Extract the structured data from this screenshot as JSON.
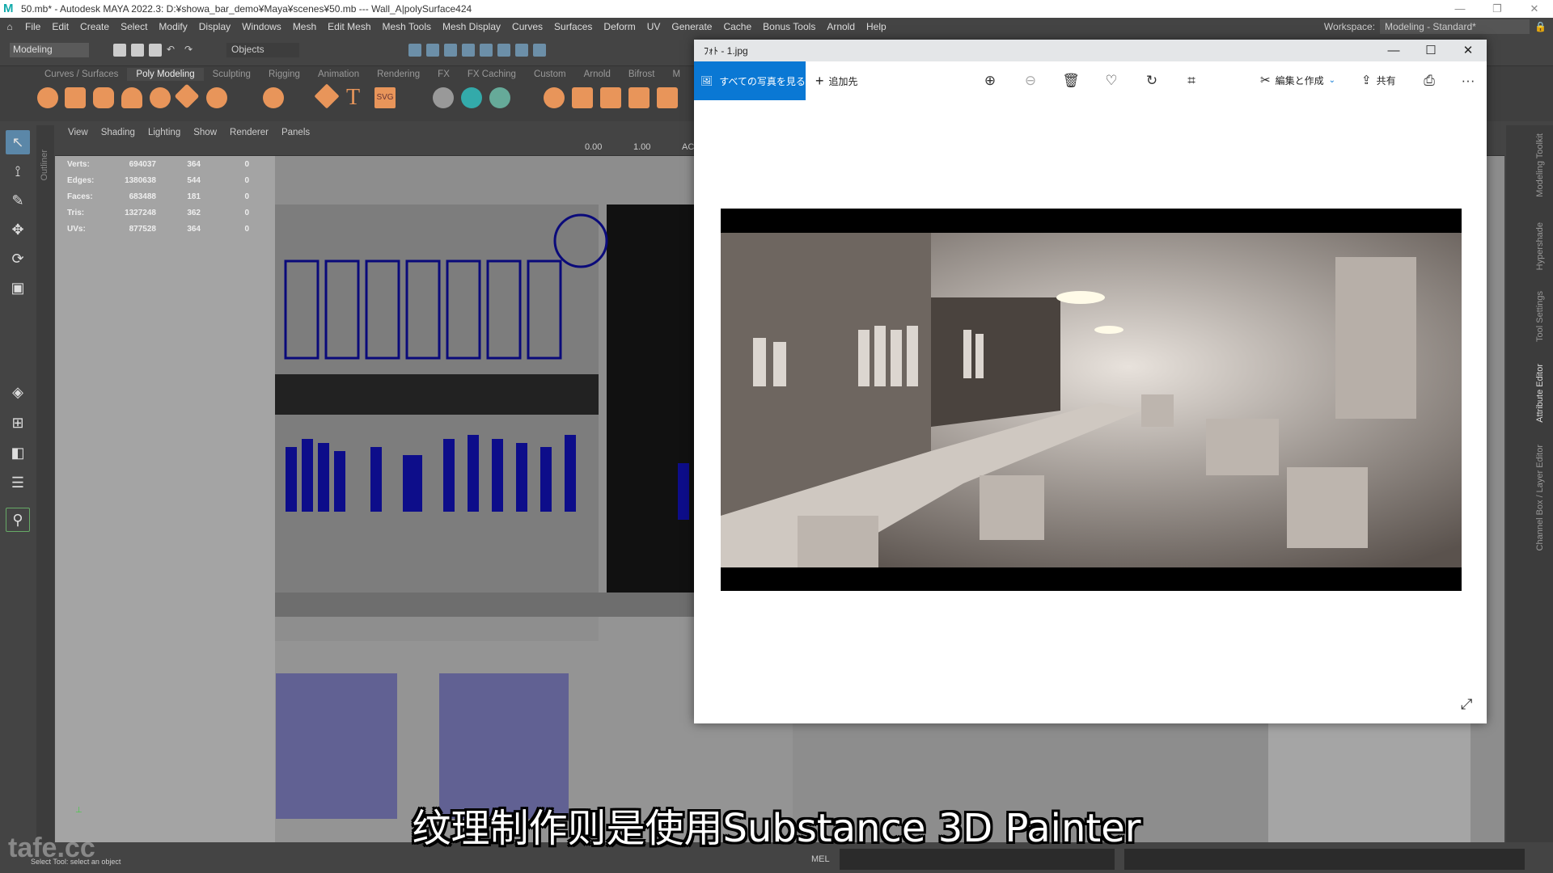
{
  "app": {
    "title": "50.mb* - Autodesk MAYA 2022.3: D:¥showa_bar_demo¥Maya¥scenes¥50.mb  ---  Wall_A|polySurface424",
    "logo": "M",
    "window_buttons": [
      "—",
      "❐",
      "✕"
    ]
  },
  "menu": [
    "File",
    "Edit",
    "Create",
    "Select",
    "Modify",
    "Display",
    "Windows",
    "Mesh",
    "Edit Mesh",
    "Mesh Tools",
    "Mesh Display",
    "Curves",
    "Surfaces",
    "Deform",
    "UV",
    "Generate",
    "Cache",
    "Bonus Tools",
    "Arnold",
    "Help"
  ],
  "workspace": {
    "label": "Workspace:",
    "value": "Modeling - Standard*"
  },
  "toolbar": {
    "mode": "Modeling",
    "selection_mask": "Objects"
  },
  "shelf": {
    "tabs": [
      "Curves / Surfaces",
      "Poly Modeling",
      "Sculpting",
      "Rigging",
      "Animation",
      "Rendering",
      "FX",
      "FX Caching",
      "Custom",
      "Arnold",
      "Bifrost",
      "M"
    ],
    "active_tab": "Poly Modeling",
    "svg_label": "SVG"
  },
  "outliner_label": "Outliner",
  "viewport": {
    "menu": [
      "View",
      "Shading",
      "Lighting",
      "Show",
      "Renderer",
      "Panels"
    ],
    "exposure": "0.00",
    "gamma": "1.00",
    "ac_label": "AC",
    "stats": [
      {
        "label": "Verts:",
        "total": "694037",
        "selected": "364",
        "third": "0"
      },
      {
        "label": "Edges:",
        "total": "1380638",
        "selected": "544",
        "third": "0"
      },
      {
        "label": "Faces:",
        "total": "683488",
        "selected": "181",
        "third": "0"
      },
      {
        "label": "Tris:",
        "total": "1327248",
        "selected": "362",
        "third": "0"
      },
      {
        "label": "UVs:",
        "total": "877528",
        "selected": "364",
        "third": "0"
      }
    ]
  },
  "side_tabs": [
    "Modeling Toolkit",
    "Hypershade",
    "Tool Settings",
    "Attribute Editor",
    "Channel Box / Layer Editor"
  ],
  "status": {
    "message": "Select Tool: select an object",
    "mel_label": "MEL"
  },
  "watermark": "tafe.cc",
  "subtitle": "纹理制作则是使用Substance 3D Painter",
  "photos": {
    "title": "ﾌｫﾄ - 1.jpg",
    "window_buttons": [
      "—",
      "☐",
      "✕"
    ],
    "see_all": "すべての写真を見る",
    "add_to": "追加先",
    "edit_create": "編集と作成",
    "share": "共有",
    "more": "···",
    "accent_color": "#0a78d4"
  }
}
